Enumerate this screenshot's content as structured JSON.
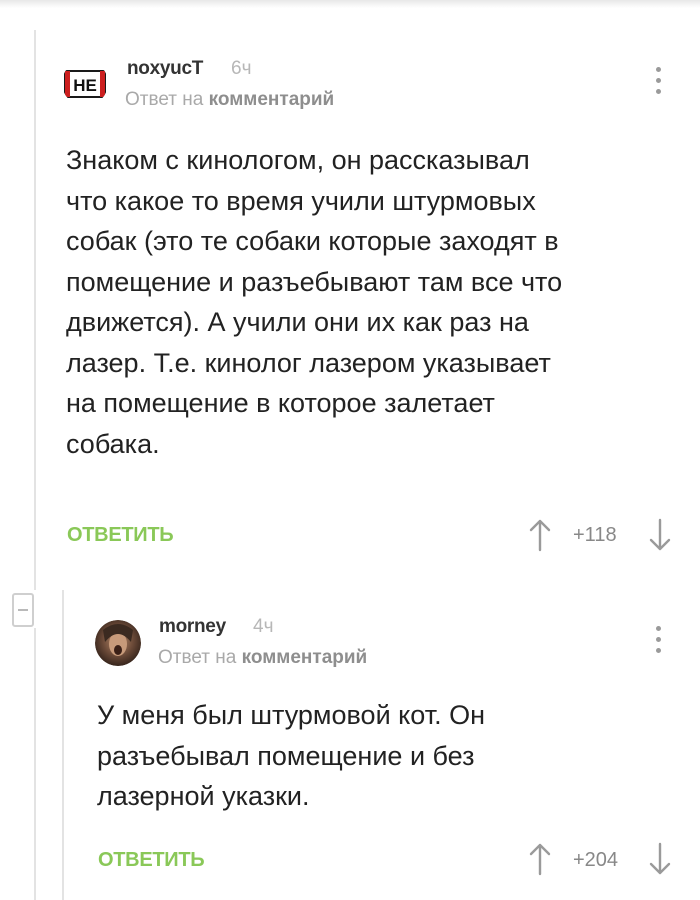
{
  "comments": [
    {
      "author": "noxyucT",
      "time": "6ч",
      "reply_prefix": "Ответ на",
      "reply_target": "комментарий",
      "avatar_text": "НЕ",
      "body_lines": [
        "Знаком с кинологом, он рассказывал",
        "что какое то время учили штурмовых",
        "собак (это те собаки которые заходят в",
        "помещение и разъебывают там все что",
        "движется). А учили они их как раз на",
        "лазер. Т.е. кинолог лазером указывает",
        "на помещение в которое залетает",
        "собака."
      ],
      "reply_label": "ОТВЕТИТЬ",
      "rating": "+118"
    },
    {
      "author": "morney",
      "time": "4ч",
      "reply_prefix": "Ответ на",
      "reply_target": "комментарий",
      "body_lines": [
        "У меня был штурмовой кот. Он",
        "разъебывал помещение и без",
        "лазерной указки."
      ],
      "reply_label": "ОТВЕТИТЬ",
      "rating": "+204"
    }
  ],
  "colors": {
    "accent_green": "#8ac858",
    "text": "#222222",
    "muted": "#a9a9a9"
  },
  "icons": [
    "kebab-menu-icon",
    "upvote-arrow-icon",
    "downvote-arrow-icon",
    "collapse-icon",
    "avatar"
  ]
}
